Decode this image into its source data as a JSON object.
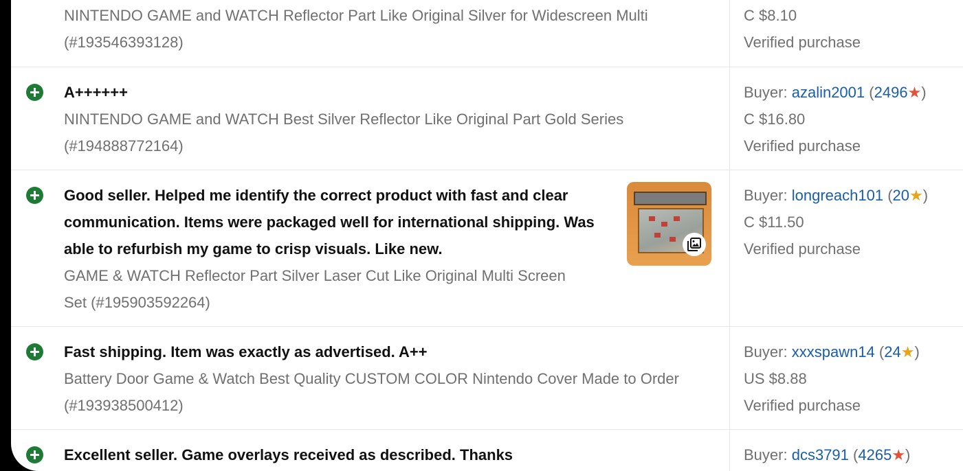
{
  "reviews": [
    {
      "comment": "",
      "item_lines": [
        "NINTENDO GAME and WATCH Reflector Part Like Original Silver for Widescreen Multi",
        "(#193546393128)"
      ],
      "buyer_label": "",
      "buyer_name": "",
      "buyer_score": "",
      "price": "C $8.10",
      "verified": "Verified purchase"
    },
    {
      "comment": "A++++++",
      "item_lines": [
        "NINTENDO GAME and WATCH Best Silver Reflector Like Original Part Gold Series",
        "(#194888772164)"
      ],
      "buyer_label": "Buyer:",
      "buyer_name": "azalin2001",
      "buyer_score": "2496",
      "star_color": "red",
      "price": "C $16.80",
      "verified": "Verified purchase"
    },
    {
      "comment_lines": [
        "Good seller. Helped me identify the correct product with fast and clear",
        "communication. Items were packaged well for international shipping. Was",
        "able to refurbish my game to crisp visuals. Like new."
      ],
      "item_lines": [
        "GAME & WATCH Reflector Part Silver Laser Cut Like Original Multi Screen",
        "Set (#195903592264)"
      ],
      "buyer_label": "Buyer:",
      "buyer_name": "longreach101",
      "buyer_score": "20",
      "star_color": "yellow",
      "price": "C $11.50",
      "verified": "Verified purchase"
    },
    {
      "comment": "Fast shipping. Item was exactly as advertised. A++",
      "item_lines": [
        "Battery Door Game & Watch Best Quality CUSTOM COLOR Nintendo Cover Made to Order",
        "(#193938500412)"
      ],
      "buyer_label": "Buyer:",
      "buyer_name": "xxxspawn14",
      "buyer_score": "24",
      "star_color": "yellow",
      "price": "US $8.88",
      "verified": "Verified purchase"
    },
    {
      "comment": "Excellent seller. Game overlays received as described. Thanks",
      "buyer_label": "Buyer:",
      "buyer_name": "dcs3791",
      "buyer_score": "4265",
      "star_color": "red"
    }
  ],
  "punct": {
    "open": "(",
    "close": ")",
    "star": "★"
  },
  "icons": {
    "positive": "plus-circle-icon",
    "photos": "photo-gallery-icon"
  },
  "colors": {
    "positive": "#1f7a35",
    "link": "#1a5ea8",
    "star_red": "#e0533b",
    "star_yellow": "#e8a317"
  }
}
